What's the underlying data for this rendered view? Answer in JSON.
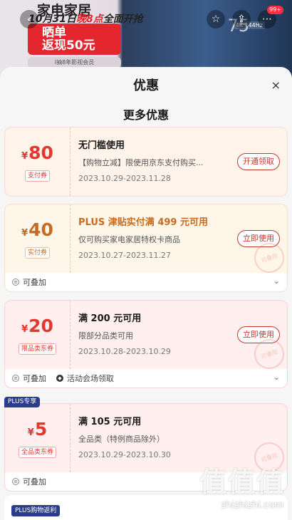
{
  "background": {
    "title": "家电家居",
    "subtitle_pre": "10月31日",
    "subtitle_em": "晚8点",
    "subtitle_post": "全面开抢",
    "banner": "晒单\n返现50元",
    "banner_note": "I抽8年影视会员",
    "count": "75",
    "badge": "99+",
    "tv_tag": "4K 144Hz",
    "back_icon": "chevron-left-icon",
    "icons": [
      "star-icon",
      "share-icon",
      "more-icon"
    ]
  },
  "sheet": {
    "title": "优惠",
    "close": "×",
    "section_title": "更多优惠"
  },
  "coupons": [
    {
      "currency": "¥",
      "amount": "80",
      "tag": "支付券",
      "line1": "无门槛使用",
      "line2": "【购物立减】限使用京东支付购买...",
      "line3": "2023.10.29-2023.11.28",
      "button": "开通领取"
    },
    {
      "currency": "¥",
      "amount": "40",
      "tag": "实付券",
      "line1": "PLUS 津贴实付满 499 元可用",
      "line2": "仅可购买家电家居特权卡商品",
      "line3": "2023.10.27-2023.11.27",
      "button": "立即使用",
      "stamp": "可叠加",
      "foot": "可叠加"
    },
    {
      "currency": "¥",
      "amount": "20",
      "tag": "限品类东券",
      "line1": "满 200 元可用",
      "line2": "限部分品类可用",
      "line3": "2023.10.28-2023.10.29",
      "button": "立即使用",
      "stamp": "可叠加",
      "foot": "可叠加",
      "foot2": "活动会场领取"
    },
    {
      "flag": "PLUS专享",
      "currency": "¥",
      "amount": "5",
      "tag": "全品类东券",
      "line1": "满 105 元可用",
      "line2": "全品类（特例商品除外）",
      "line3": "2023.10.29-2023.10.30",
      "stamp": "可叠加",
      "foot": "可叠加"
    }
  ],
  "bottom": {
    "label": "PLUS购物返利"
  },
  "watermark": {
    "text": "值值值",
    "url": "zhizhizhi.com"
  },
  "colors": {
    "accent": "#e3382e",
    "gold": "#c56b22",
    "plus": "#2c3c8c"
  }
}
